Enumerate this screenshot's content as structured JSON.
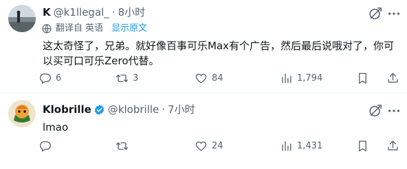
{
  "tweets": [
    {
      "name": "K",
      "handle": "@k1llegal_",
      "separator": "·",
      "time": "8小时",
      "translate": {
        "label": "翻译自 英语",
        "show_original": "显示原文"
      },
      "text": "这太奇怪了，兄弟。就好像百事可乐Max有个广告，然后最后说哦对了，你可以买可口可乐Zero代替。",
      "replies": "6",
      "retweets": "3",
      "likes": "84",
      "views": "1,794"
    },
    {
      "name": "Klobrille",
      "handle": "@klobrille",
      "separator": "·",
      "time": "7小时",
      "text": "lmao",
      "replies": "",
      "retweets": "",
      "likes": "24",
      "views": "1,431"
    }
  ],
  "colors": {
    "text": "#0f1419",
    "secondary": "#536471",
    "accent": "#1d9bf0",
    "divider": "#eff3f4"
  },
  "icons": [
    "grok-icon",
    "more-icon",
    "translate-icon",
    "verified-badge-icon",
    "reply-icon",
    "retweet-icon",
    "like-icon",
    "views-icon",
    "bookmark-icon",
    "share-icon"
  ]
}
